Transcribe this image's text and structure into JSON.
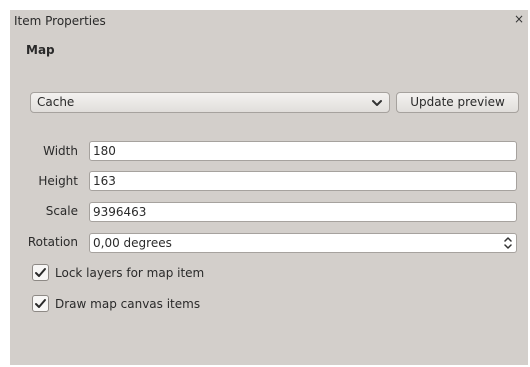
{
  "window": {
    "title": "Item Properties",
    "close_glyph": "×"
  },
  "section": {
    "title": "Map"
  },
  "cache_combo": {
    "value": "Cache",
    "icon": "chevron-down-icon"
  },
  "update_button": {
    "label": "Update preview"
  },
  "fields": {
    "width": {
      "label": "Width",
      "value": "180"
    },
    "height": {
      "label": "Height",
      "value": "163"
    },
    "scale": {
      "label": "Scale",
      "value": "9396463"
    },
    "rotation": {
      "label": "Rotation",
      "value": "0,00 degrees",
      "icon": "spinner-arrows-icon"
    }
  },
  "options": {
    "lock_layers": {
      "label": "Lock layers for map item",
      "checked": true
    },
    "draw_canvas": {
      "label": "Draw map canvas items",
      "checked": true
    }
  },
  "colors": {
    "panel_bg": "#d3cfcb",
    "field_bg": "#ffffff",
    "border": "#a6a29e"
  }
}
